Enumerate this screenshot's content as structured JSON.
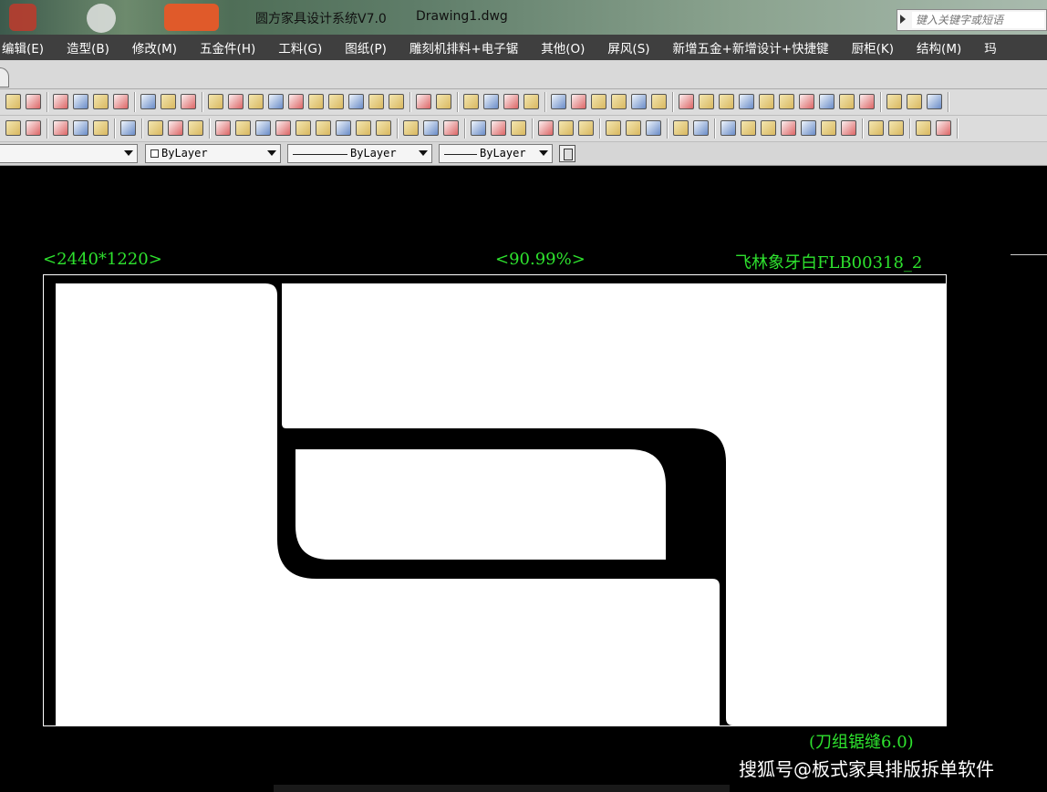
{
  "window": {
    "title": "圆方家具设计系统V7.0",
    "document": "Drawing1.dwg",
    "search_placeholder": "键入关键字或短语"
  },
  "menu": {
    "items": [
      "编辑(E)",
      "造型(B)",
      "修改(M)",
      "五金件(H)",
      "工料(G)",
      "图纸(P)",
      "雕刻机排料+电子锯",
      "其他(O)",
      "屏风(S)",
      "新增五金+新增设计+快捷键",
      "厨柜(K)",
      "结构(M)",
      "玛"
    ]
  },
  "properties": {
    "color": "ByLayer",
    "linetype": "ByLayer",
    "lineweight": "ByLayer"
  },
  "drawing": {
    "sheet_size": "<2440*1220>",
    "usage_percent": "<90.99%>",
    "material": "飞林象牙白FLB00318_2",
    "kerf": "(刀组锯缝6.0)"
  },
  "watermark": "搜狐号@板式家具排版拆单软件",
  "colors": {
    "label_green": "#2ee22e",
    "canvas_bg": "#000000",
    "panel_fill": "#ffffff",
    "menubar_bg": "#3f3f3f"
  }
}
